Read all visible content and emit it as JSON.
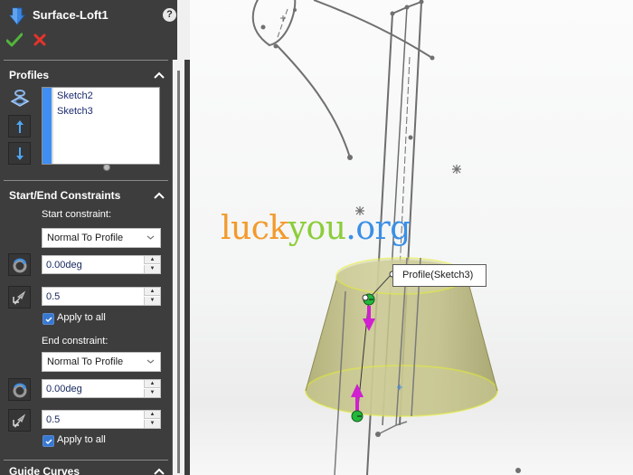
{
  "property_manager": {
    "title": "Surface-Loft1",
    "feature_icon": "loft-surface-icon",
    "help_label": "?",
    "ok_icon": "checkmark-icon",
    "cancel_icon": "close-x-icon",
    "accent_color": "#3e8ef3",
    "sections": {
      "profiles": {
        "title": "Profiles",
        "items": [
          "Sketch2",
          "Sketch3"
        ],
        "buttons": [
          "select-profiles-icon",
          "move-up-icon",
          "move-down-icon"
        ]
      },
      "constraints": {
        "title": "Start/End Constraints",
        "start_label": "Start constraint:",
        "start_value": "Normal To Profile",
        "start_angle": "0.00deg",
        "start_tangent_length": "0.5",
        "start_apply_all": "Apply to all",
        "start_apply_all_checked": true,
        "end_label": "End constraint:",
        "end_value": "Normal To Profile",
        "end_angle": "0.00deg",
        "end_tangent_length": "0.5",
        "end_apply_all": "Apply to all",
        "end_apply_all_checked": true
      },
      "guide_curves": {
        "title": "Guide Curves"
      }
    }
  },
  "viewport": {
    "watermark": {
      "part1": "luck",
      "part2": "you",
      "part3": ".org"
    },
    "callout": "Profile(Sketch3)",
    "colors": {
      "surface_fill": "#b8b67a",
      "edge_highlight": "#e6f03a",
      "handle_magenta": "#d020d0",
      "handle_green": "#22b83a",
      "sketch_gray": "#777777"
    }
  }
}
